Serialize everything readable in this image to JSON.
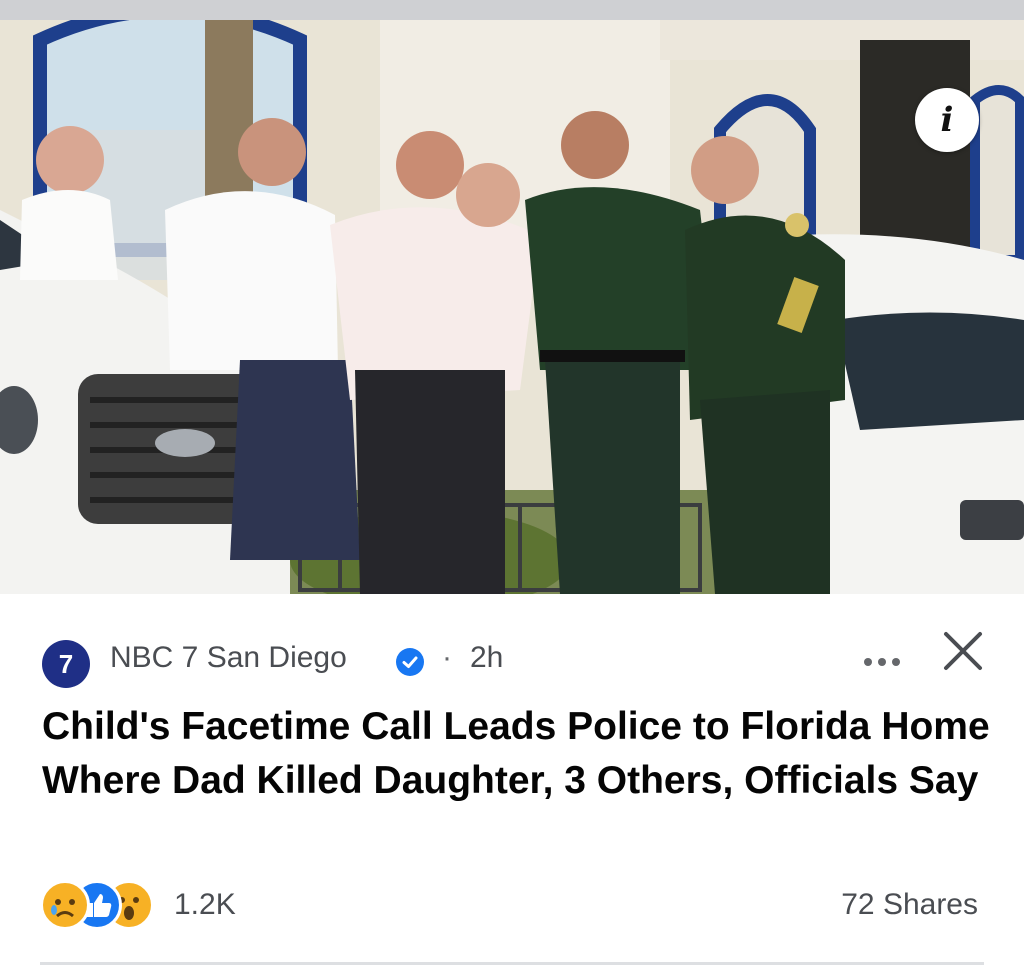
{
  "post": {
    "source_name": "NBC 7 San Diego",
    "source_logo_text": "7",
    "separator": "·",
    "time_ago": "2h",
    "headline": "Child's Facetime Call Leads Police to Florida Home Where Dad Killed Daughter, 3 Others, Officials Say",
    "reaction_count": "1.2K",
    "shares": "72 Shares",
    "reactions": [
      "sad-reaction-icon",
      "like-reaction-icon",
      "wow-reaction-icon"
    ],
    "info_icon": "i"
  },
  "colors": {
    "verified": "#1877f2",
    "logo_bg": "#1f2f86",
    "like": "#1877f2",
    "reaction_yellow": "#f7b125",
    "secondary_text": "#65676b"
  }
}
